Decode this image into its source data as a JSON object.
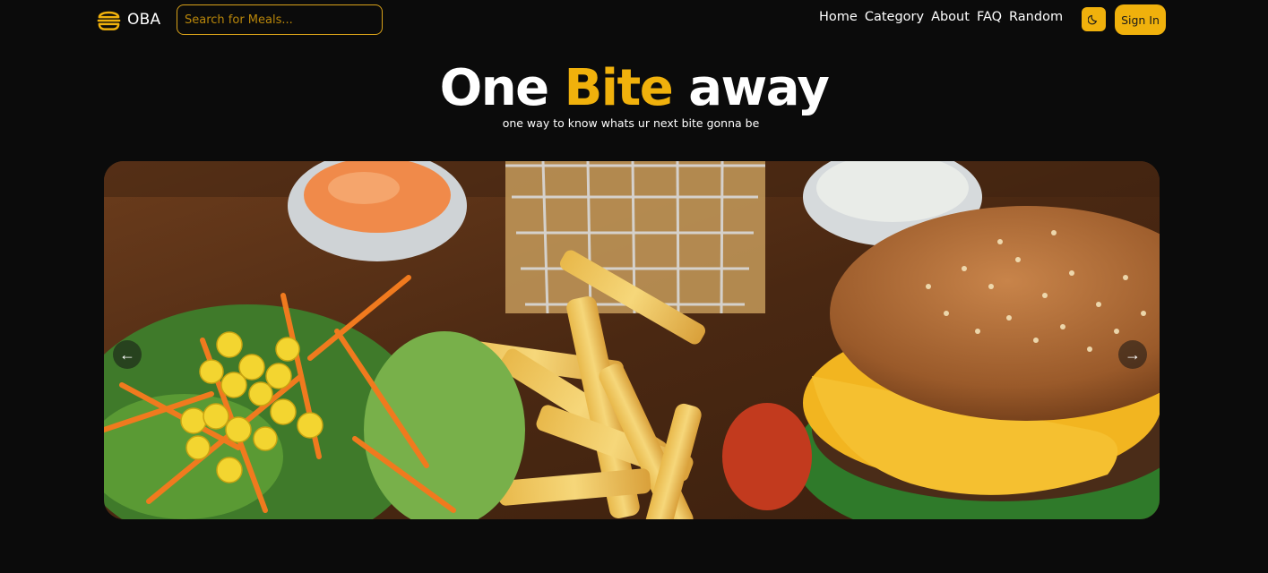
{
  "navbar": {
    "brand_name": "OBA",
    "search_placeholder": "Search for Meals...",
    "links": [
      "Home",
      "Category",
      "About",
      "FAQ",
      "Random"
    ],
    "theme_icon": "moon-icon",
    "signin_label": "Sign In"
  },
  "hero": {
    "title_start": "One ",
    "title_accent": "Bite",
    "title_end": " away",
    "subtitle": "one way to know whats ur next bite gonna be"
  },
  "carousel": {
    "prev_label": "←",
    "next_label": "→",
    "image_description": "burger-fries-salad"
  },
  "colors": {
    "accent": "#f0b10c",
    "background": "#0b0b0b",
    "text": "#ffffff"
  }
}
